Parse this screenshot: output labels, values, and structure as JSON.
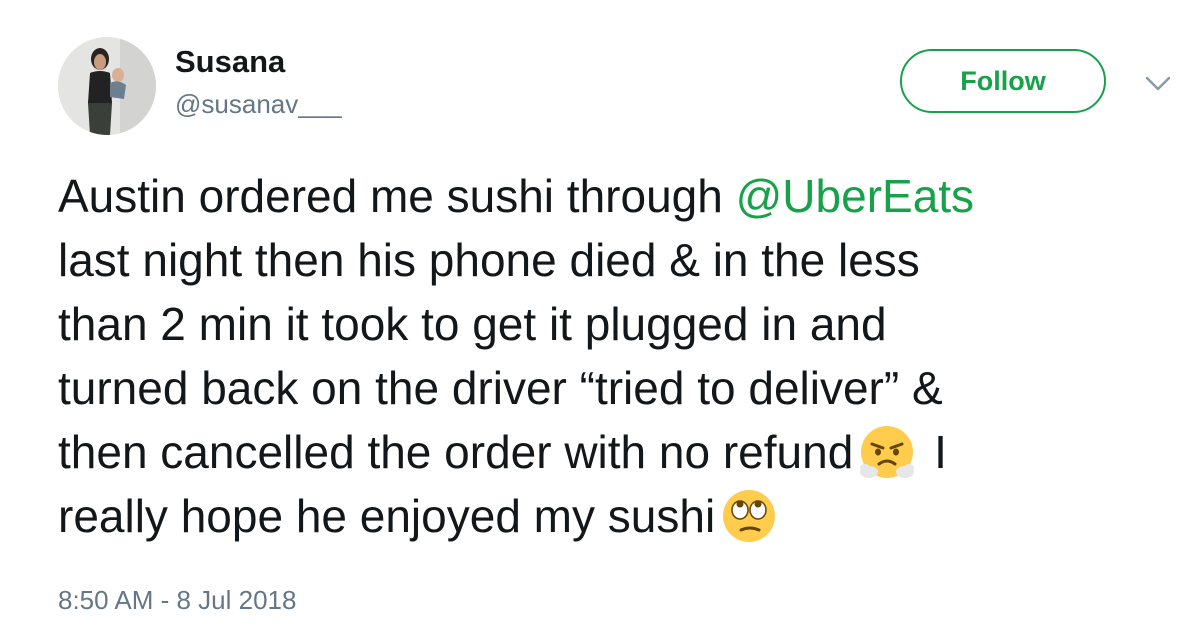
{
  "user": {
    "display_name": "Susana",
    "handle": "@susanav___"
  },
  "actions": {
    "follow_label": "Follow",
    "menu_icon": "chevron-down-icon"
  },
  "tweet": {
    "line1_text": "Austin ordered me sushi through ",
    "line1_mention": "@UberEats",
    "line2": "last night then his phone died & in the less",
    "line3": "than 2 min it took to get it plugged in and",
    "line4": "turned back on the driver “tried to deliver” &",
    "line5_text": "then cancelled the order with no refund",
    "line5_emoji": "face-with-steam-from-nose-emoji",
    "line5_after": " I",
    "line6_text": "really hope he enjoyed my sushi",
    "line6_emoji": "face-with-rolling-eyes-emoji",
    "timestamp": "8:50 AM - 8 Jul 2018"
  },
  "colors": {
    "accent": "#17a24a",
    "text": "#14171a",
    "muted": "#657786"
  }
}
